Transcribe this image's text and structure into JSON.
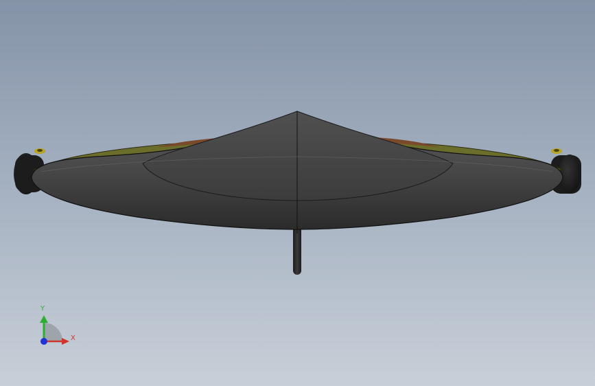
{
  "viewport": {
    "model": "hydrofoil wing",
    "view": "front"
  },
  "triad": {
    "y_label": "Y",
    "x_label": "X",
    "y_color": "#2fae34",
    "x_color": "#d2332b",
    "z_color": "#2233d6"
  },
  "colors": {
    "background_top": "#8593a8",
    "background_bottom": "#c8cfd8",
    "wing_body": "#4a4a4a",
    "wing_top": "#6b6d2a",
    "wing_top_accent": "#7a4a2c",
    "wing_tip": "#1f1f1f",
    "tip_bolt": "#b8a425",
    "mast": "#2a2a2a"
  }
}
